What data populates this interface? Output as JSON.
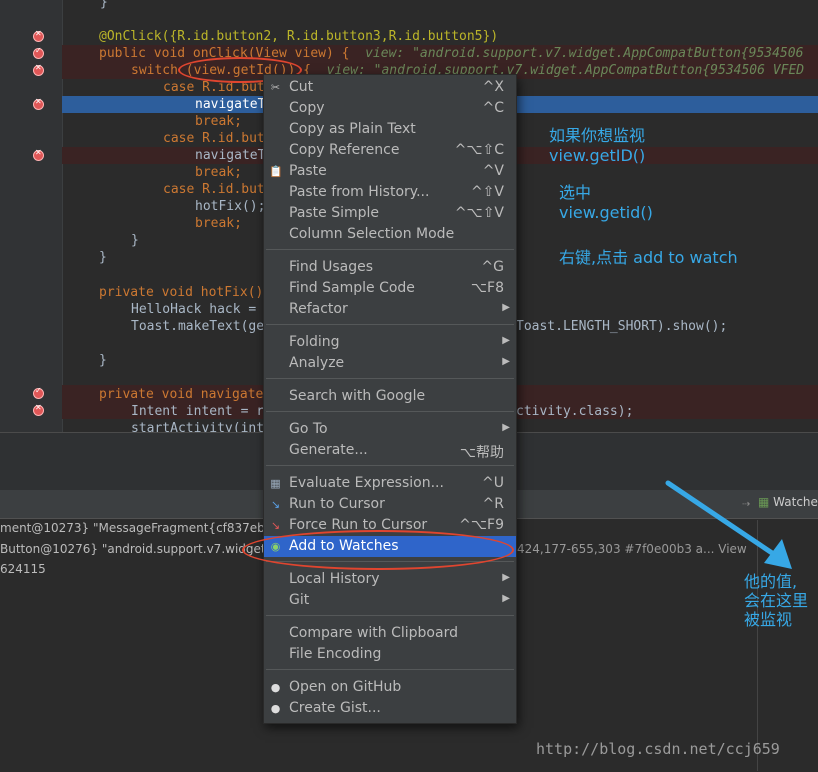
{
  "editor": {
    "lines": {
      "closing_brace_top": "}",
      "annotation": "@OnClick({R.id.button2, R.id.button3,R.id.button5})",
      "method_sig": "public void onClick(View view) {",
      "method_sig_debug": "view: \"android.support.v7.widget.AppCompatButton{9534506",
      "switch_stmt": "switch (view.getId()) {",
      "switch_debug": "view: \"android.support.v7.widget.AppCompatButton{9534506 VFED",
      "case1": "case R.id.butto",
      "navigate1": "navigateT",
      "break1": "break;",
      "case2": "case R.id.but",
      "navigate2": "navigateT",
      "break2": "break;",
      "case3": "case R.id.but",
      "hotfix_call": "hotFix();",
      "break3": "break;",
      "close_switch": "}",
      "close_method": "}",
      "hotfix_sig": "private void hotFix()",
      "hellohack": "HelloHack hack =",
      "toast_start": "Toast.makeText(ge",
      "toast_end": "Toast.LENGTH_SHORT).show();",
      "close_hotfix": "}",
      "navigate_sig": "private void navigate",
      "intent_start": "Intent intent = r",
      "intent_end": "ctivity.class);",
      "start_activity": "startActivity(int"
    }
  },
  "debugger": {
    "watches_tab": "Watche",
    "variables": [
      "ment@10273} \"MessageFragment{cf837eb #0",
      "Button@10276} \"android.support.v7.widget.A",
      "624115"
    ],
    "var_tail": "424,177-655,303 #7f0e00b3 a... View"
  },
  "context_menu": {
    "items": [
      {
        "label": "Cut",
        "shortcut": "^X",
        "icon": "scissors-icon"
      },
      {
        "label": "Copy",
        "shortcut": "^C",
        "icon": "copy-icon"
      },
      {
        "label": "Copy as Plain Text",
        "shortcut": ""
      },
      {
        "label": "Copy Reference",
        "shortcut": "^⌥⇧C"
      },
      {
        "label": "Paste",
        "shortcut": "^V",
        "icon": "paste-icon"
      },
      {
        "label": "Paste from History...",
        "shortcut": "^⇧V"
      },
      {
        "label": "Paste Simple",
        "shortcut": "^⌥⇧V"
      },
      {
        "label": "Column Selection Mode",
        "shortcut": ""
      },
      {
        "label": "Find Usages",
        "shortcut": "^G"
      },
      {
        "label": "Find Sample Code",
        "shortcut": "⌥F8"
      },
      {
        "label": "Refactor",
        "submenu": true
      },
      {
        "label": "Folding",
        "submenu": true
      },
      {
        "label": "Analyze",
        "submenu": true
      },
      {
        "label": "Search with Google",
        "shortcut": ""
      },
      {
        "label": "Go To",
        "submenu": true
      },
      {
        "label": "Generate...",
        "shortcut": "⌥帮助"
      },
      {
        "label": "Evaluate Expression...",
        "shortcut": "^U",
        "icon": "calculator-icon"
      },
      {
        "label": "Run to Cursor",
        "shortcut": "^R",
        "icon": "run-to-cursor-icon"
      },
      {
        "label": "Force Run to Cursor",
        "shortcut": "^⌥F9",
        "icon": "force-run-to-cursor-icon"
      },
      {
        "label": "Add to Watches",
        "shortcut": "",
        "icon": "watches-icon",
        "selected": true
      },
      {
        "label": "Local History",
        "submenu": true
      },
      {
        "label": "Git",
        "submenu": true
      },
      {
        "label": "Compare with Clipboard",
        "shortcut": ""
      },
      {
        "label": "File Encoding",
        "shortcut": ""
      },
      {
        "label": "Open on GitHub",
        "shortcut": "",
        "icon": "github-icon"
      },
      {
        "label": "Create Gist...",
        "shortcut": "",
        "icon": "github-icon"
      }
    ]
  },
  "annotations": {
    "note1_line1": "如果你想监视",
    "note1_line2": "view.getID()",
    "note2_line1": "选中",
    "note2_line2": "view.getid()",
    "note3": "右键,点击 add to watch",
    "note4_line1": "他的值,",
    "note4_line2": "会在这里",
    "note4_line3": "被监视"
  },
  "watermark": "http://blog.csdn.net/ccj659",
  "colors": {
    "annotation_blue": "#37a8e6",
    "highlight_ellipse": "#e0452f",
    "menu_selection": "#2f65ca"
  }
}
